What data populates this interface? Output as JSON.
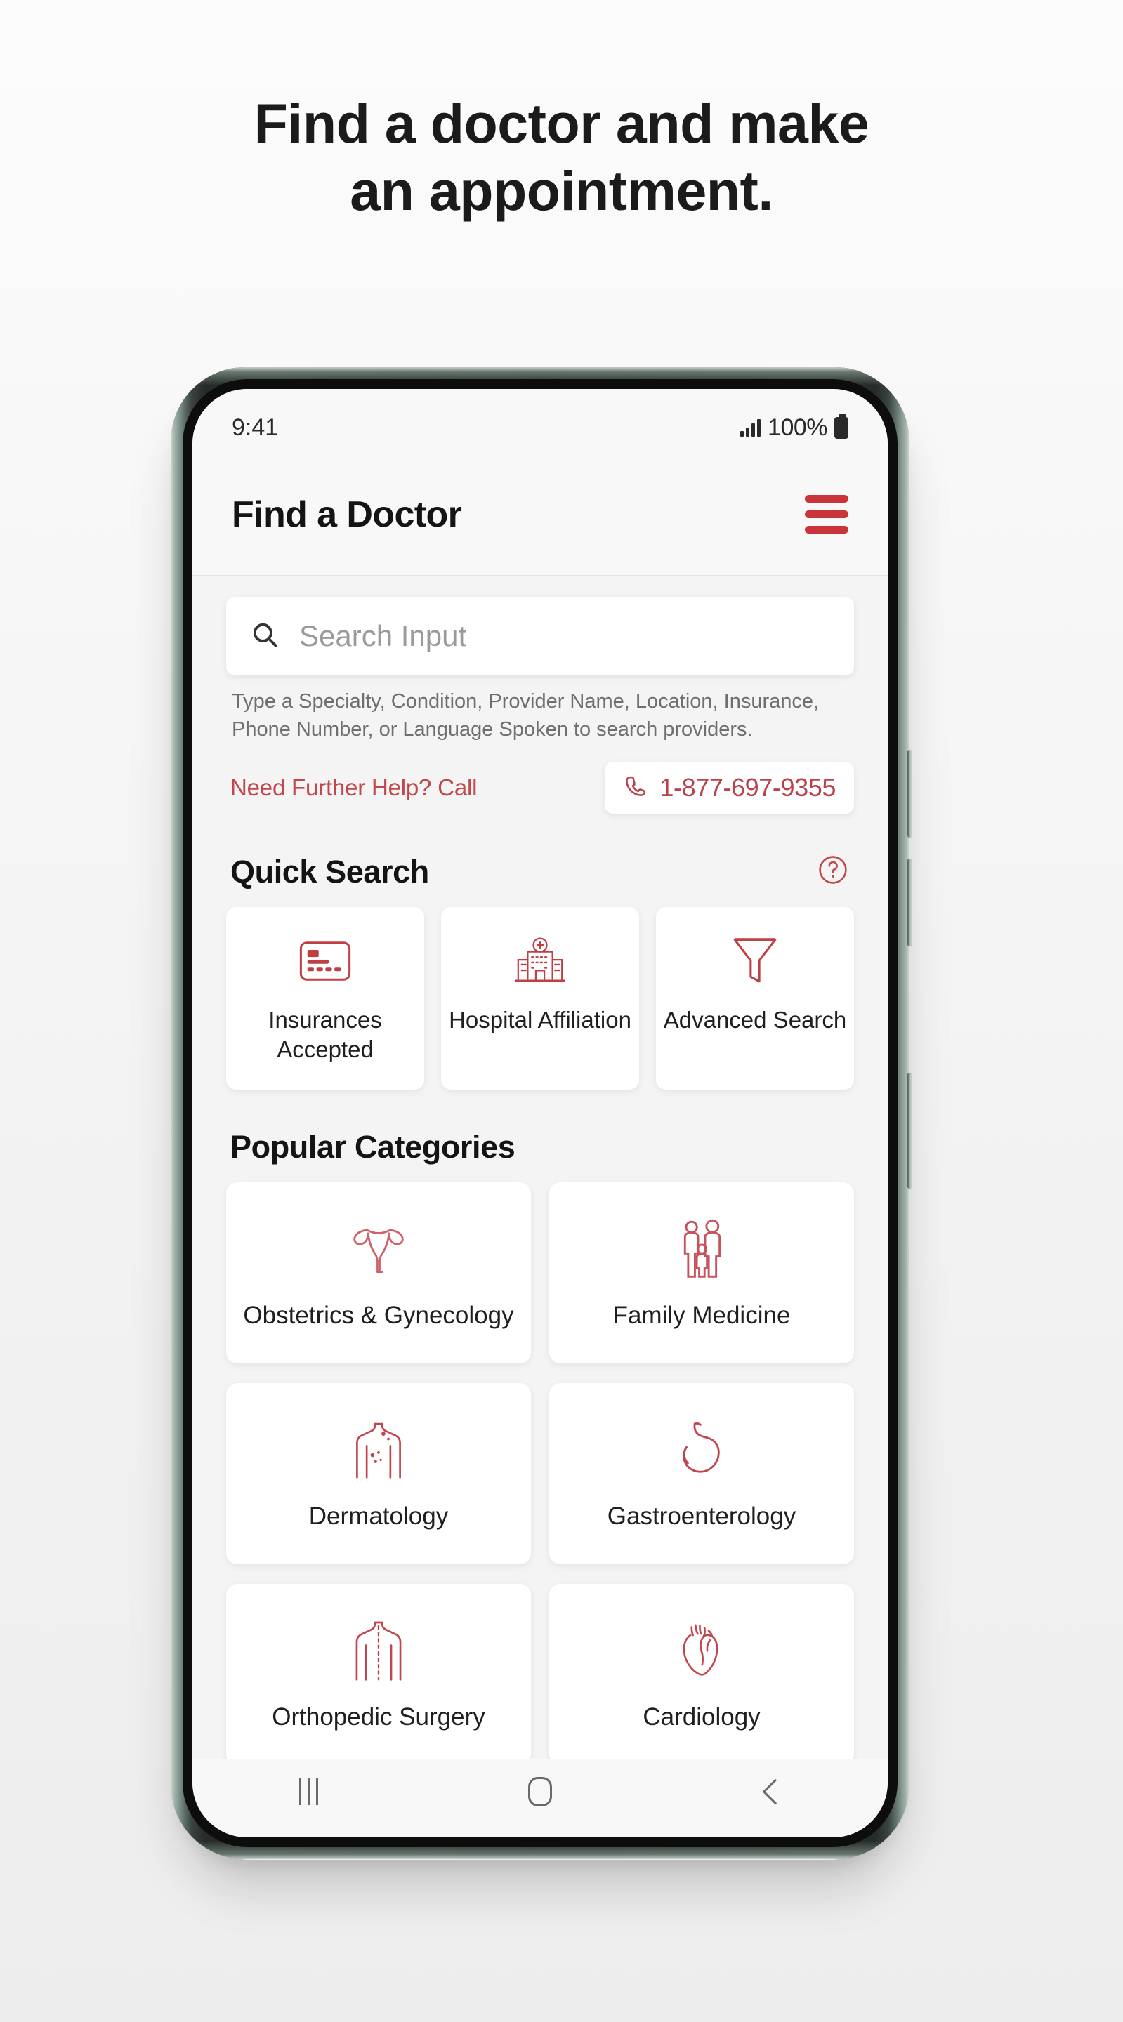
{
  "page": {
    "headline_line1": "Find a doctor and make",
    "headline_line2": "an appointment."
  },
  "colors": {
    "brand_red": "#c9353b",
    "link_red": "#b8414a",
    "text_dark": "#141414",
    "muted": "#6f6f6f",
    "screen_bg": "#f4f4f4"
  },
  "phone": {
    "statusbar": {
      "time": "9:41",
      "battery_percent": "100%",
      "signal_icon": "signal-bars-icon",
      "battery_icon": "battery-full-icon"
    },
    "navbar": {
      "recents_icon": "recents-icon",
      "home_icon": "home-icon",
      "back_icon": "back-icon"
    }
  },
  "app": {
    "title": "Find a Doctor",
    "menu_icon": "hamburger-menu-icon"
  },
  "search": {
    "icon": "search-icon",
    "value": "",
    "placeholder": "Search Input",
    "helper_text": "Type a Specialty, Condition, Provider Name, Location, Insurance, Phone Number, or Language Spoken to search providers."
  },
  "help_call": {
    "label": "Need Further Help? Call",
    "phone_icon": "phone-handset-icon",
    "number": "1-877-697-9355"
  },
  "quick_search": {
    "title": "Quick Search",
    "help_icon": "question-mark-circle-icon",
    "items": [
      {
        "label": "Insurances Accepted",
        "icon": "insurance-card-icon"
      },
      {
        "label": "Hospital Affiliation",
        "icon": "hospital-building-icon"
      },
      {
        "label": "Advanced Search",
        "icon": "funnel-filter-icon"
      }
    ]
  },
  "popular_categories": {
    "title": "Popular Categories",
    "items": [
      {
        "label": "Obstetrics & Gynecology",
        "icon": "uterus-icon"
      },
      {
        "label": "Family Medicine",
        "icon": "family-people-icon"
      },
      {
        "label": "Dermatology",
        "icon": "torso-skin-icon"
      },
      {
        "label": "Gastroenterology",
        "icon": "stomach-icon"
      },
      {
        "label": "Orthopedic Surgery",
        "icon": "spine-back-icon"
      },
      {
        "label": "Cardiology",
        "icon": "heart-anatomical-icon"
      }
    ]
  }
}
